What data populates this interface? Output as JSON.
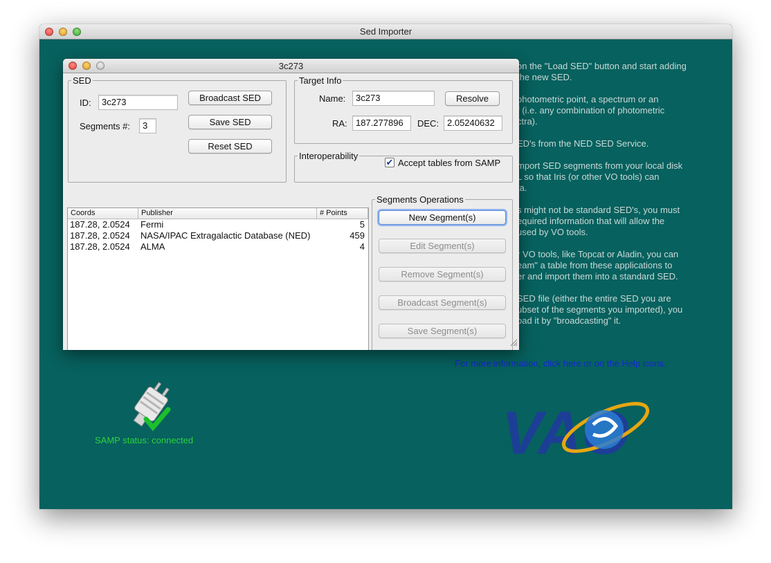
{
  "main_window": {
    "title": "Sed Importer"
  },
  "help": {
    "paragraphs": [
      "on the \"Load SED\" button and start adding\nthe new SED.",
      "photometric point, a spectrum or an\nf (i.e. any combination of photometric\nctra).",
      "ED's from the NED SED Service.",
      "mport SED segments from your local disk\nL so that Iris (or other VO tools) can\nta.",
      "s might not be standard SED's, you must\nequired information that will allow the\nused by VO tools.",
      "r VO tools, like Topcat or Aladin, you can\neam\" a table from these applications to\ner and import them into a standard SED.",
      "SED file (either the entire SED you are\nubset of the segments you imported), you\noad it by \"broadcasting\" it."
    ],
    "link": "For more information, click here or on the Help icons."
  },
  "samp": {
    "status": "SAMP status: connected"
  },
  "logo": {
    "text": "VAO"
  },
  "dialog": {
    "title": "3c273",
    "sed_group": {
      "legend": "SED",
      "id_label": "ID:",
      "id_value": "3c273",
      "segments_label": "Segments #:",
      "segments_value": "3",
      "broadcast_label": "Broadcast SED",
      "save_label": "Save SED",
      "reset_label": "Reset SED"
    },
    "target_group": {
      "legend": "Target Info",
      "name_label": "Name:",
      "name_value": "3c273",
      "resolve_label": "Resolve",
      "ra_label": "RA:",
      "ra_value": "187.277896",
      "dec_label": "DEC:",
      "dec_value": "2.05240632"
    },
    "interop_group": {
      "legend": "Interoperability",
      "accept_label": "Accept tables from SAMP",
      "accept_checked": "✔"
    },
    "table": {
      "headers": [
        "Coords",
        "Publisher",
        "# Points"
      ],
      "rows": [
        [
          "187.28, 2.0524",
          "Fermi",
          "5"
        ],
        [
          "187.28, 2.0524",
          "NASA/IPAC Extragalactic Database (NED)",
          "459"
        ],
        [
          "187.28, 2.0524",
          "ALMA",
          "4"
        ]
      ]
    },
    "ops_group": {
      "legend": "Segments Operations",
      "new_label": "New Segment(s)",
      "edit_label": "Edit Segment(s)",
      "remove_label": "Remove Segment(s)",
      "broadcast_label": "Broadcast Segment(s)",
      "save_label": "Save Segment(s)"
    }
  }
}
